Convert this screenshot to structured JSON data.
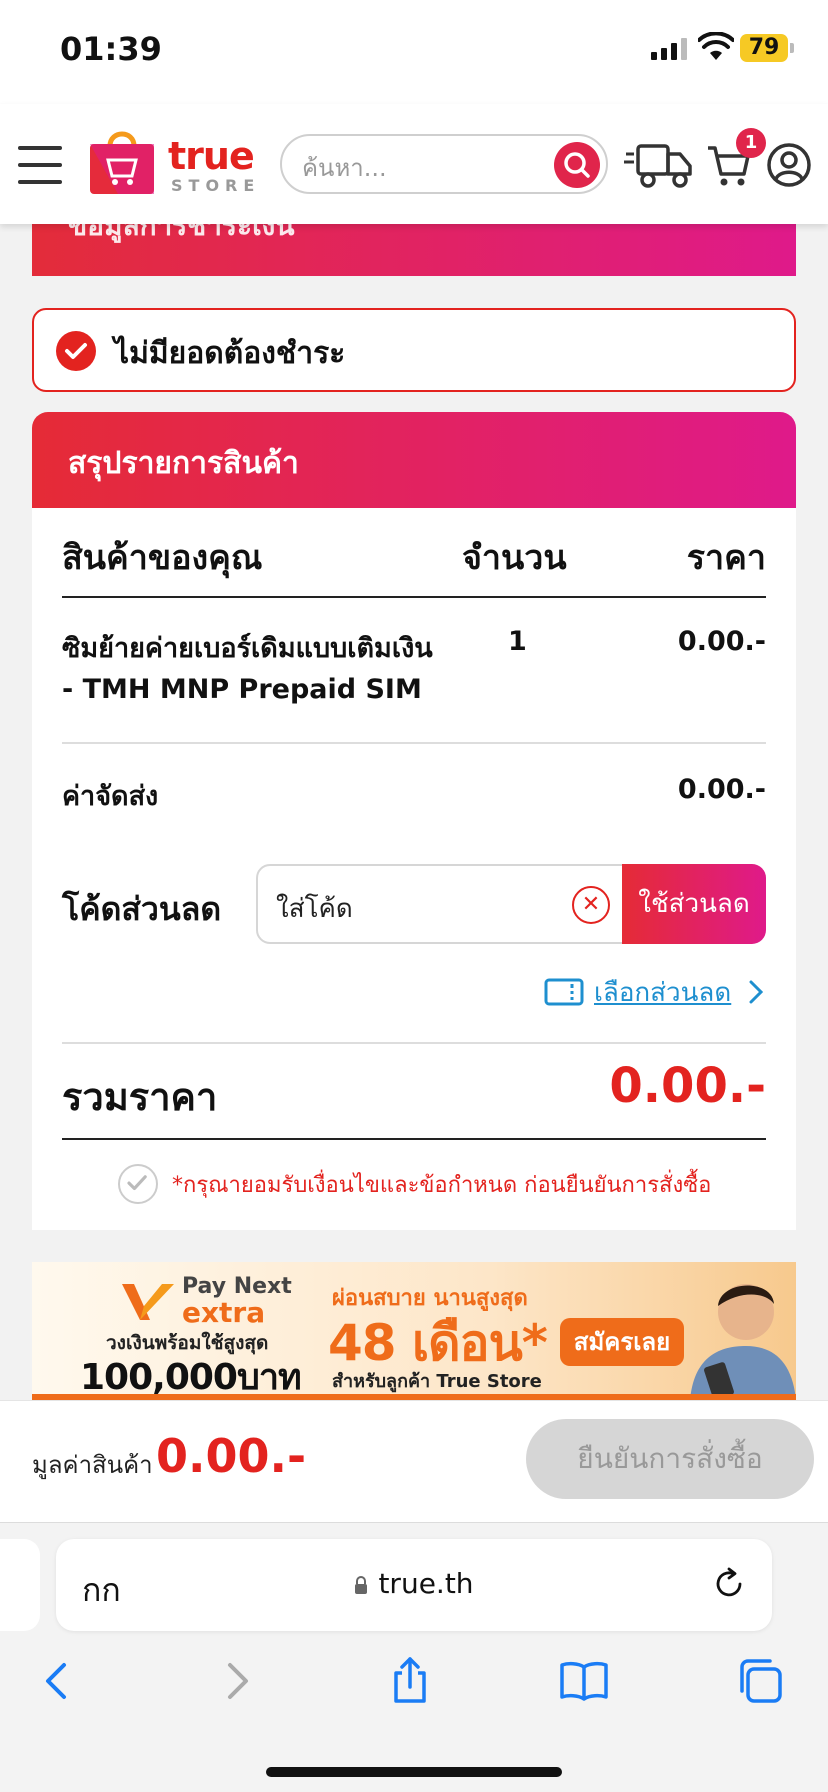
{
  "status_bar": {
    "time": "01:39",
    "battery": "79"
  },
  "header": {
    "logo_main": "true",
    "logo_sub": "STORE",
    "search_placeholder": "ค้นหา...",
    "cart_count": "1"
  },
  "payment_section": {
    "title": "ข้อมูลการชำระเงิน"
  },
  "no_payment": {
    "text": "ไม่มียอดต้องชำระ"
  },
  "summary": {
    "title": "สรุปรายการสินค้า",
    "columns": {
      "product": "สินค้าของคุณ",
      "qty": "จำนวน",
      "price": "ราคา"
    },
    "items": [
      {
        "name_line1": "ซิมย้ายค่ายเบอร์เดิมแบบเติมเงิน",
        "name_line2": "- TMH MNP Prepaid SIM",
        "qty": "1",
        "price": "0.00.-"
      }
    ],
    "shipping_label": "ค่าจัดส่ง",
    "shipping_value": "0.00.-",
    "coupon_label": "โค้ดส่วนลด",
    "coupon_placeholder": "ใส่โค้ด",
    "coupon_apply": "ใช้ส่วนลด",
    "choose_coupon": "เลือกส่วนลด",
    "total_label": "รวมราคา",
    "total_value": "0.00.-",
    "terms_text": "*กรุณายอมรับเงื่อนไขและข้อกำหนด ก่อนยืนยันการสั่งซื้อ"
  },
  "banner": {
    "brand_top": "Pay Next",
    "brand_bottom": "extra",
    "credit_line": "วงเงินพร้อมใช้สูงสุด",
    "credit_amount": "100,000บาท",
    "slogan": "ผ่อนสบาย นานสูงสุด",
    "months": "48 เดือน*",
    "for_customers": "สำหรับลูกค้า True Store",
    "cta": "สมัครเลย"
  },
  "footer": {
    "label": "มูลค่าสินค้า",
    "value": "0.00.-",
    "confirm": "ยืนยันการสั่งซื้อ"
  },
  "browser": {
    "aa": "กก",
    "url": "true.th"
  },
  "colors": {
    "brand_red": "#e3231f",
    "gradient_end": "#df1a8a",
    "link_blue": "#1e8fcf",
    "banner_orange": "#ef6c1a"
  }
}
